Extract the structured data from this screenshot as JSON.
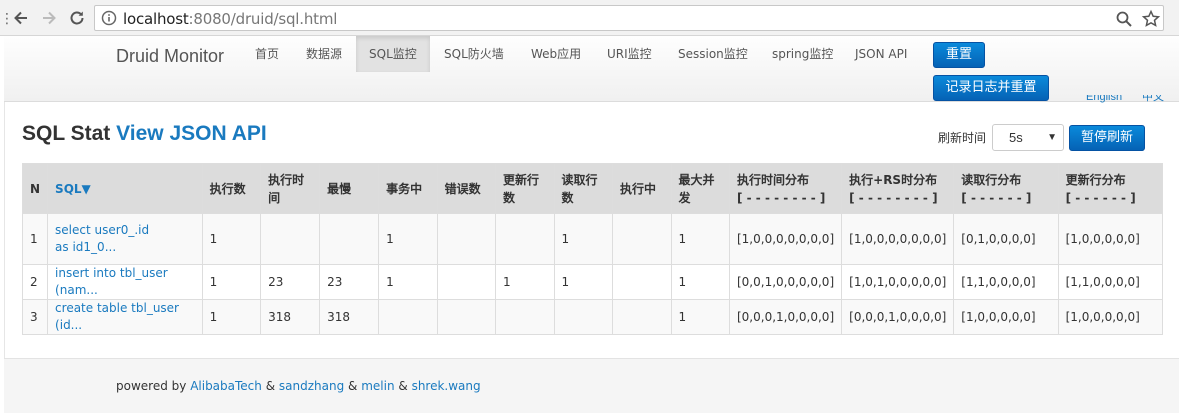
{
  "browser": {
    "url_host": "localhost",
    "url_rest": ":8080/druid/sql.html"
  },
  "navbar": {
    "brand": "Druid Monitor",
    "items": [
      {
        "label": "首页"
      },
      {
        "label": "数据源"
      },
      {
        "label": "SQL监控",
        "active": true
      },
      {
        "label": "SQL防火墙"
      },
      {
        "label": "Web应用"
      },
      {
        "label": "URI监控"
      },
      {
        "label": "Session监控"
      },
      {
        "label": "spring监控"
      },
      {
        "label": "JSON API"
      }
    ],
    "reset_label": "重置",
    "log_reset_label": "记录日志并重置",
    "lang_en": "English",
    "lang_zh": "中文"
  },
  "header": {
    "title_plain": "SQL Stat ",
    "title_link": "View JSON API",
    "refresh_label": "刷新时间",
    "refresh_value": "5s",
    "pause_label": "暂停刷新"
  },
  "table": {
    "columns": [
      [
        "N"
      ],
      [
        "SQL▼"
      ],
      [
        "执行数"
      ],
      [
        "执行时",
        "间"
      ],
      [
        "最慢"
      ],
      [
        "事务中"
      ],
      [
        "错误数"
      ],
      [
        "更新行",
        "数"
      ],
      [
        "读取行",
        "数"
      ],
      [
        "执行中"
      ],
      [
        "最大并",
        "发"
      ],
      [
        "执行时间分布",
        "[ - - - - - - - - ]"
      ],
      [
        "执行+RS时分布",
        "[ - - - - - - - - ]"
      ],
      [
        "读取行分布",
        "[ - - - - - - ]"
      ],
      [
        "更新行分布",
        "[ - - - - - - ]"
      ]
    ],
    "rows": [
      [
        "1",
        "select user0_.id as id1_0...",
        "1",
        "",
        "",
        "1",
        "",
        "",
        "1",
        "",
        "1",
        "[1,0,0,0,0,0,0,0]",
        "[1,0,0,0,0,0,0,0]",
        "[0,1,0,0,0,0]",
        "[1,0,0,0,0,0]"
      ],
      [
        "2",
        "insert into tbl_user (nam...",
        "1",
        "23",
        "23",
        "1",
        "",
        "1",
        "1",
        "",
        "1",
        "[0,0,1,0,0,0,0,0]",
        "[1,0,1,0,0,0,0,0]",
        "[1,1,0,0,0,0]",
        "[1,1,0,0,0,0]"
      ],
      [
        "3",
        "create table tbl_user (id...",
        "1",
        "318",
        "318",
        "",
        "",
        "",
        "",
        "",
        "1",
        "[0,0,0,1,0,0,0,0]",
        "[0,0,0,1,0,0,0,0]",
        "[1,0,0,0,0,0]",
        "[1,0,0,0,0,0]"
      ]
    ]
  },
  "footer": {
    "prefix": "powered by ",
    "author1": "AlibabaTech",
    "sep": " & ",
    "author2": "sandzhang",
    "author3": "melin",
    "author4": "shrek.wang"
  },
  "colors": {
    "accent": "#1a7abf",
    "button": "#0562b5"
  }
}
